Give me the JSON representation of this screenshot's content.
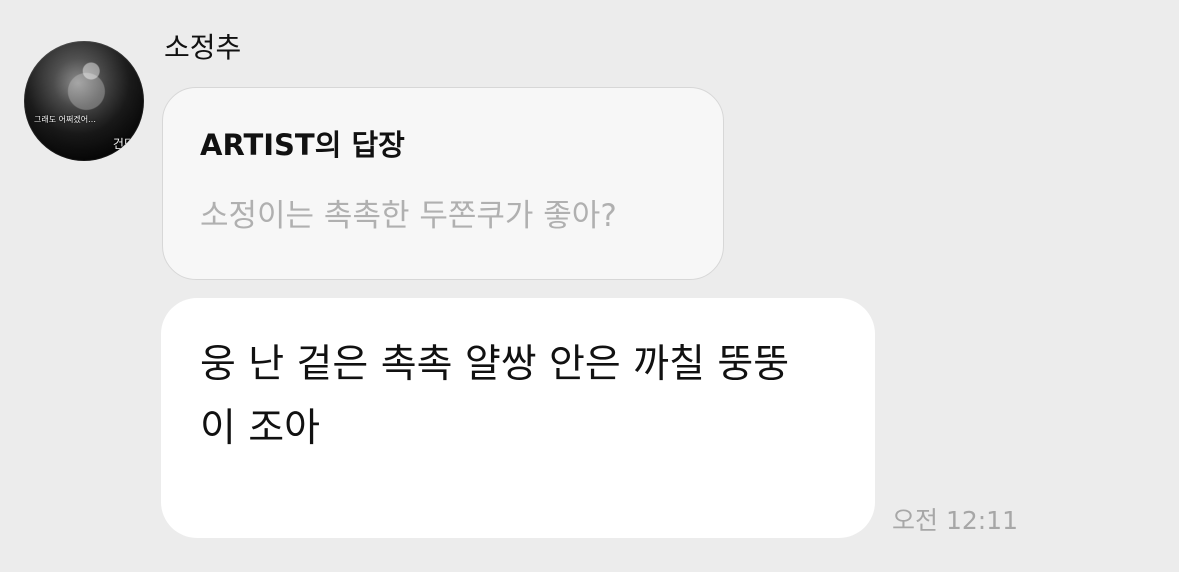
{
  "chat": {
    "sender": {
      "name": "소정추",
      "avatar": {
        "caption": "그래도 어쩌겠어…",
        "corner_text": "건덕"
      }
    },
    "reply_context": {
      "title": "ARTIST의 답장",
      "quoted_text": "소정이는 촉촉한 두쫀쿠가 좋아?"
    },
    "message": {
      "lines": [
        "웅 난 겉은 촉촉 얄쌍 안은 까칠 뚱뚱",
        "이 조아"
      ],
      "timestamp": "오전 12:11"
    }
  },
  "colors": {
    "background": "#ececec",
    "reply_card": "#f7f7f7",
    "message_bubble": "#ffffff",
    "primary_text": "#111111",
    "secondary_text": "#b0b0b0",
    "timestamp": "#a7a7a7"
  }
}
